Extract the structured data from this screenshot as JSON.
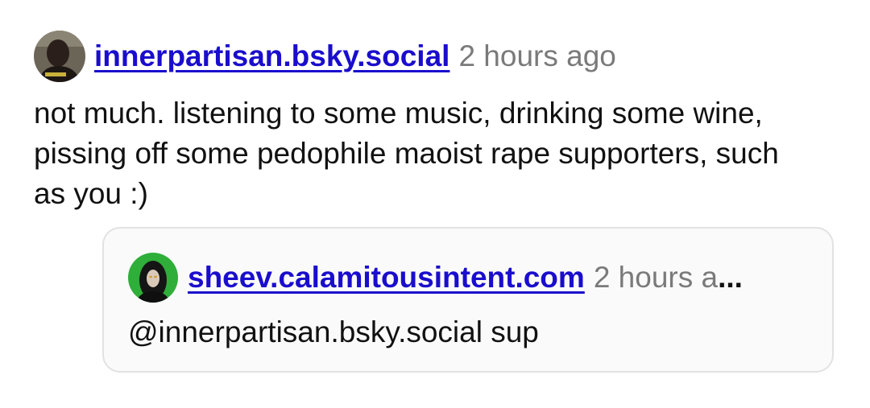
{
  "post": {
    "author_handle": "innerpartisan.bsky.social",
    "timestamp": "2 hours ago",
    "text": "not much. listening to some music, drinking some wine, pissing off some pedophile maoist rape supporters, such as you :)",
    "avatar_icon": "user-avatar-icon"
  },
  "quoted_post": {
    "author_handle": "sheev.calamitousintent.com",
    "timestamp": "2 hours a",
    "ellipsis": "...",
    "text": "@innerpartisan.bsky.social sup",
    "avatar_icon": "user-avatar-icon"
  },
  "colors": {
    "link": "#1a0dcc",
    "timestamp": "#7a7a7a",
    "quote_border": "#e2e2e2",
    "quote_background": "#fafafa"
  }
}
